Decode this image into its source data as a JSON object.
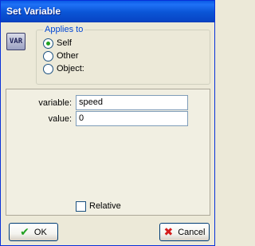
{
  "window": {
    "title": "Set Variable"
  },
  "action_icon": {
    "label": "VAR",
    "icon": "var-action-icon"
  },
  "applies_to": {
    "legend": "Applies to",
    "options": [
      {
        "label": "Self",
        "checked": true
      },
      {
        "label": "Other",
        "checked": false
      },
      {
        "label": "Object:",
        "checked": false
      }
    ]
  },
  "fields": {
    "variable_label": "variable:",
    "variable_value": "speed",
    "value_label": "value:",
    "value_value": "0"
  },
  "relative": {
    "label": "Relative",
    "checked": false
  },
  "buttons": {
    "ok_label": "OK",
    "cancel_label": "Cancel"
  },
  "colors": {
    "ok_check": "#21a121",
    "cancel_x": "#d41c1c",
    "title_bar": "#0a55d6",
    "legend_text": "#0046d5"
  }
}
